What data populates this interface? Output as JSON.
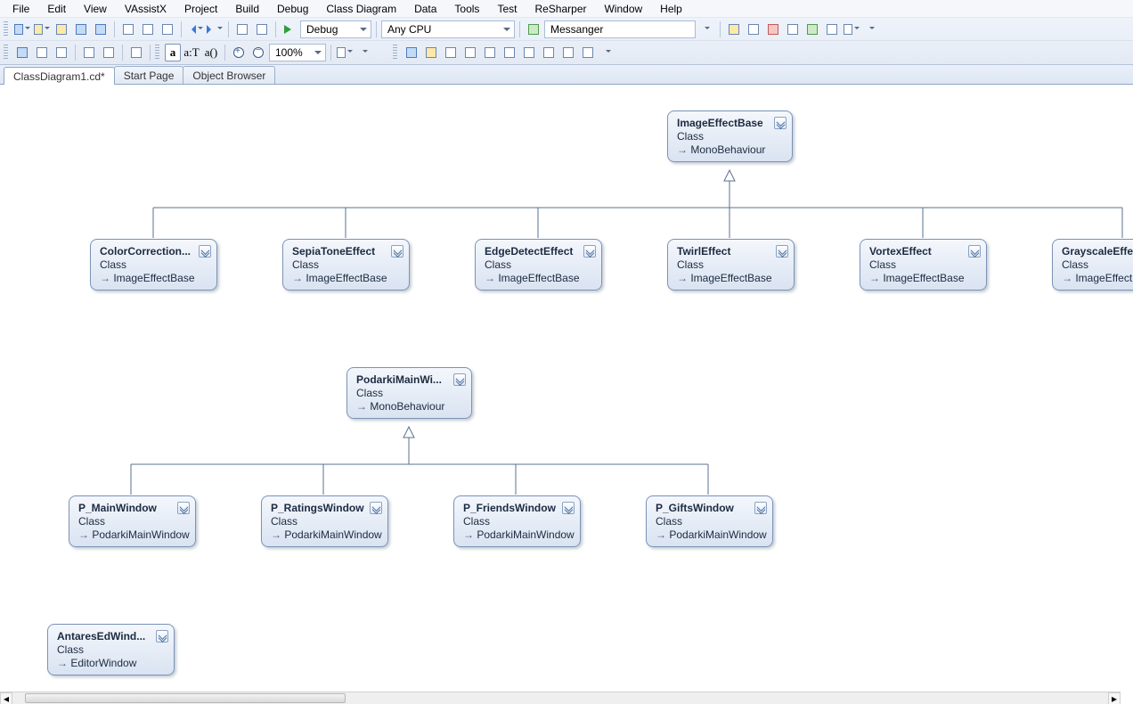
{
  "menu": [
    "File",
    "Edit",
    "View",
    "VAssistX",
    "Project",
    "Build",
    "Debug",
    "Class Diagram",
    "Data",
    "Tools",
    "Test",
    "ReSharper",
    "Window",
    "Help"
  ],
  "toolbar": {
    "config": "Debug",
    "platform": "Any CPU",
    "search": "Messanger",
    "zoom": "100%",
    "fbox": "a",
    "fmt_at": "a:T",
    "fmt_ap": "a()"
  },
  "tabs": [
    {
      "label": "ClassDiagram1.cd*",
      "active": true
    },
    {
      "label": "Start Page",
      "active": false
    },
    {
      "label": "Object Browser",
      "active": false
    }
  ],
  "nodes": {
    "imgBase": {
      "title": "ImageEffectBase",
      "stype": "Class",
      "base": "MonoBehaviour"
    },
    "color": {
      "title": "ColorCorrection...",
      "stype": "Class",
      "base": "ImageEffectBase"
    },
    "sepia": {
      "title": "SepiaToneEffect",
      "stype": "Class",
      "base": "ImageEffectBase"
    },
    "edge": {
      "title": "EdgeDetectEffect",
      "stype": "Class",
      "base": "ImageEffectBase"
    },
    "twirl": {
      "title": "TwirlEffect",
      "stype": "Class",
      "base": "ImageEffectBase"
    },
    "vortex": {
      "title": "VortexEffect",
      "stype": "Class",
      "base": "ImageEffectBase"
    },
    "gray": {
      "title": "GrayscaleEffec",
      "stype": "Class",
      "base": "ImageEffectBa"
    },
    "podBase": {
      "title": "PodarkiMainWi...",
      "stype": "Class",
      "base": "MonoBehaviour"
    },
    "pMain": {
      "title": "P_MainWindow",
      "stype": "Class",
      "base": "PodarkiMainWindow"
    },
    "pRatings": {
      "title": "P_RatingsWindow",
      "stype": "Class",
      "base": "PodarkiMainWindow"
    },
    "pFriends": {
      "title": "P_FriendsWindow",
      "stype": "Class",
      "base": "PodarkiMainWindow"
    },
    "pGifts": {
      "title": "P_GiftsWindow",
      "stype": "Class",
      "base": "PodarkiMainWindow"
    },
    "antares": {
      "title": "AntaresEdWind...",
      "stype": "Class",
      "base": "EditorWindow"
    }
  }
}
